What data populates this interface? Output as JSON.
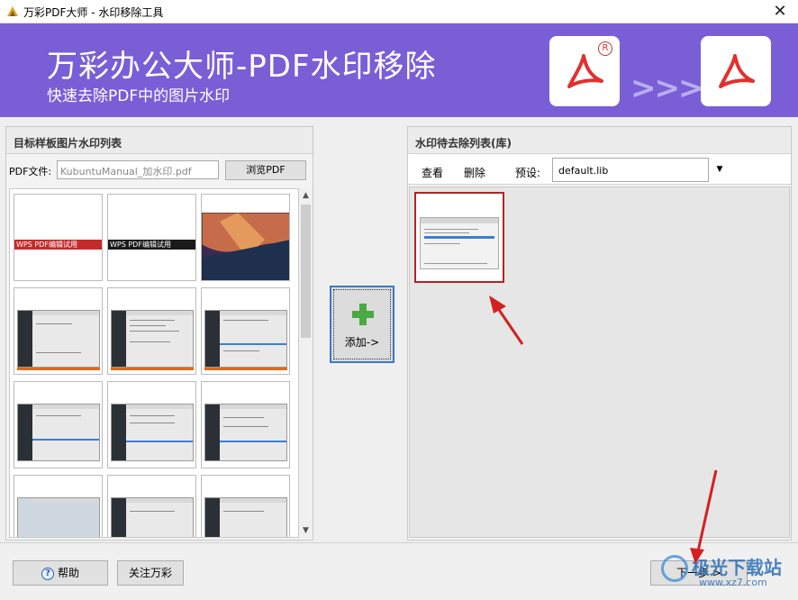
{
  "window": {
    "title": "万彩PDF大师 - 水印移除工具",
    "close_glyph": "✕"
  },
  "banner": {
    "heading": "万彩办公大师-PDF水印移除",
    "subheading": "快速去除PDF中的图片水印",
    "arrows": ">>>",
    "registered_mark": "R",
    "background_color": "#7a5ed6"
  },
  "left_panel": {
    "header": "目标样板图片水印列表",
    "pdf_label": "PDF文件:",
    "pdf_value": "KubuntuManual_加水印.pdf",
    "browse_label": "浏览PDF",
    "thumb_wps_labels": [
      "WPS PDF编辑试用",
      "WPS PDF编辑试用"
    ]
  },
  "middle": {
    "add_label": "添加->"
  },
  "right_panel": {
    "header": "水印待去除列表(库)",
    "view_label": "查看",
    "delete_label": "删除",
    "preset_label": "预设:",
    "preset_value": "default.lib"
  },
  "footer": {
    "help_label": "帮助",
    "follow_label": "关注万彩",
    "next_label": "下一步 >"
  },
  "watermark": {
    "site_name": "极光下载站",
    "site_url": "www.xz7.com"
  },
  "colors": {
    "accent_border": "#3c78c8",
    "annotation_arrow": "#d42020",
    "selected_thumb_border": "#b02424"
  }
}
